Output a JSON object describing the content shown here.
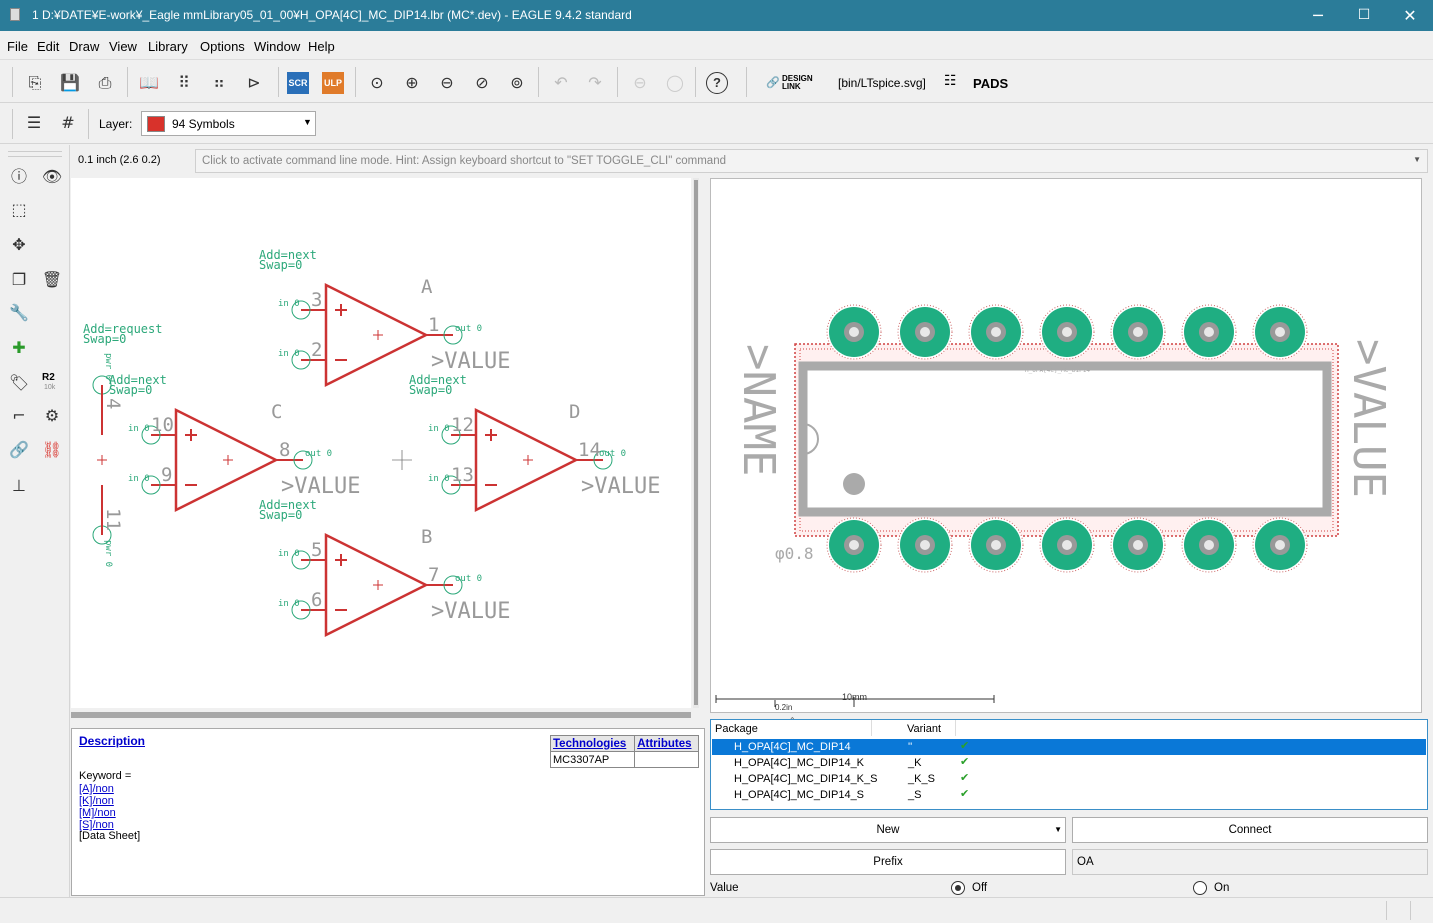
{
  "window": {
    "title": "1 D:¥DATE¥E-work¥_Eagle mmLibrary05_01_00¥H_OPA[4C]_MC_DIP14.lbr (MC*.dev) - EAGLE 9.4.2 standard",
    "minimize": "─",
    "maximize": "☐",
    "close": "✕"
  },
  "menu": [
    "File",
    "Edit",
    "Draw",
    "View",
    "Library",
    "Options",
    "Window",
    "Help"
  ],
  "toolbar": {
    "scr_label": "SCR",
    "ulp_label": "ULP",
    "help_label": "?",
    "design_link_label_1": "DESIGN",
    "design_link_label_2": "LINK",
    "ltspice_label": "[bin/LTspice.svg]",
    "pads_label": "PADS"
  },
  "layerbar": {
    "layer_label": "Layer:",
    "layer_value": "94 Symbols",
    "layer_color": "#d8322b"
  },
  "sidebar": {
    "r2_label": "R2",
    "r2_sub": "10k"
  },
  "coord_readout": "0.1 inch (2.6 0.2)",
  "command_hint": "Click to activate command line mode. Hint: Assign keyboard shortcut to \"SET TOGGLE_CLI\" command",
  "schematic": {
    "gates": [
      {
        "name": "A",
        "addlevel": "Add=next",
        "swap": "Swap=0",
        "in_plus_pin": "3",
        "in_minus_pin": "2",
        "out_pin": "1"
      },
      {
        "name": "B",
        "addlevel": "Add=next",
        "swap": "Swap=0",
        "in_plus_pin": "5",
        "in_minus_pin": "6",
        "out_pin": "7"
      },
      {
        "name": "C",
        "addlevel": "Add=next",
        "swap": "Swap=0",
        "in_plus_pin": "10",
        "in_minus_pin": "9",
        "out_pin": "8"
      },
      {
        "name": "D",
        "addlevel": "Add=next",
        "swap": "Swap=0",
        "in_plus_pin": "12",
        "in_minus_pin": "13",
        "out_pin": "14"
      }
    ],
    "power": {
      "addlevel": "Add=request",
      "swap": "Swap=0",
      "top_pin": "4",
      "bottom_pin": "11",
      "pin_label": "pwr 0"
    },
    "in_label": "in 0",
    "out_label": "out 0",
    "value_label": ">VALUE"
  },
  "package": {
    "name_label": ">NAME",
    "value_label": ">VALUE",
    "drill_label": "φ0.8",
    "pkg_text": "H_OPA[4C]_MC_DIP14",
    "scale_10mm": "10mm",
    "scale_02in": "0.2in",
    "pad_color": "#1fae82"
  },
  "description": {
    "title": "Description",
    "keyword": "Keyword =",
    "links": [
      "[A]/non",
      "[K]/non",
      "[M]/non",
      "[S]/non"
    ],
    "datasheet": "[Data Sheet]",
    "tech_header": "Technologies",
    "attr_header": "Attributes",
    "tech_value": "MC3307AP"
  },
  "packages": {
    "col_package": "Package",
    "col_variant": "Variant",
    "rows": [
      {
        "package": "H_OPA[4C]_MC_DIP14",
        "variant": "''",
        "selected": true
      },
      {
        "package": "H_OPA[4C]_MC_DIP14_K",
        "variant": "_K",
        "selected": false
      },
      {
        "package": "H_OPA[4C]_MC_DIP14_K_S",
        "variant": "_K_S",
        "selected": false
      },
      {
        "package": "H_OPA[4C]_MC_DIP14_S",
        "variant": "_S",
        "selected": false
      }
    ]
  },
  "actions": {
    "new": "New",
    "connect": "Connect",
    "prefix": "Prefix",
    "prefix_value": "OA",
    "value_label": "Value",
    "off": "Off",
    "on": "On"
  }
}
